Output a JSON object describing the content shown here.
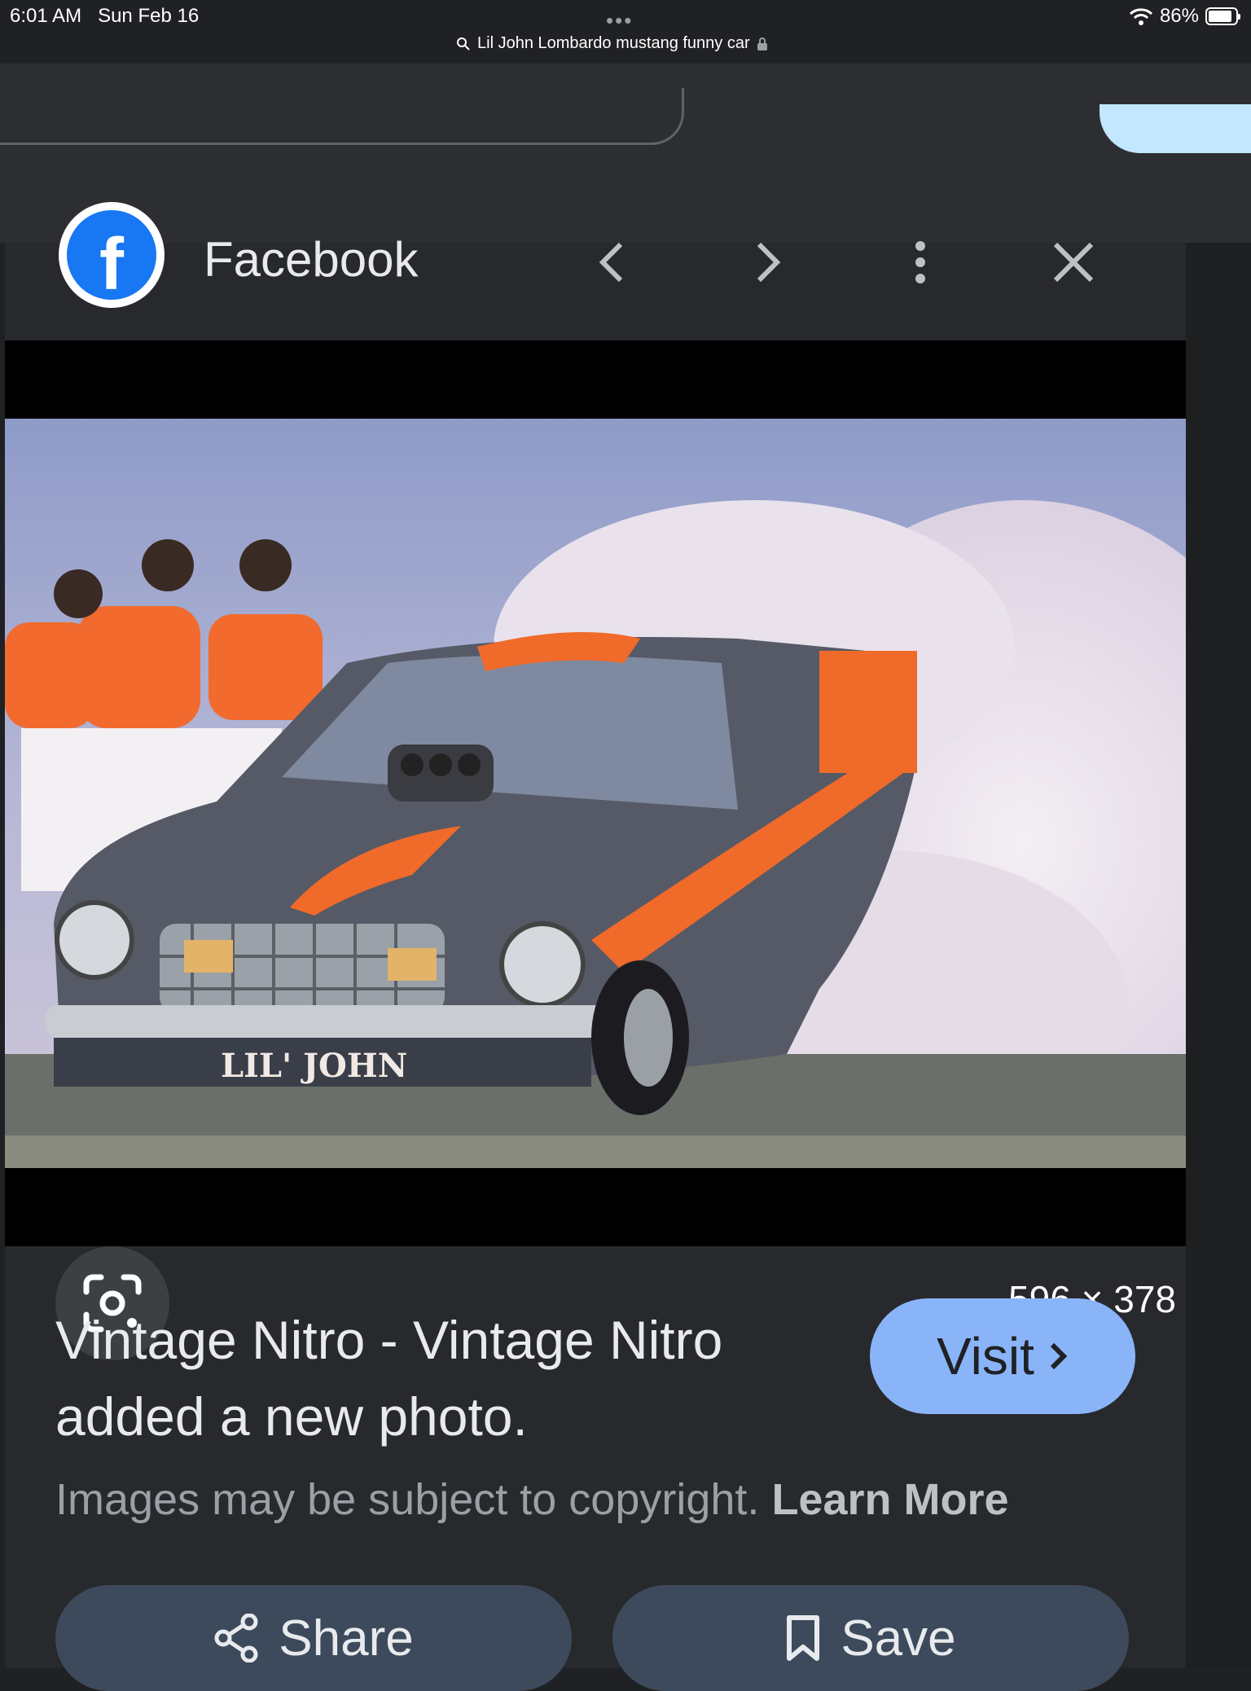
{
  "status_bar": {
    "time": "6:01 AM",
    "date": "Sun Feb 16",
    "url": "Lil John Lombardo mustang funny car",
    "battery": "86%",
    "battery_level": 0.86
  },
  "panel": {
    "source_name": "Facebook",
    "source_icon": "facebook-logo-icon",
    "image_dimensions": "596 × 378",
    "image_text": "LIL' JOHN",
    "title": "Vintage Nitro - Vintage Nitro added a new photo.",
    "visit_label": "Visit",
    "copyright_text": "Images may be subject to copyright.",
    "learn_more_label": "Learn More",
    "share_label": "Share",
    "save_label": "Save"
  },
  "colors": {
    "background": "#202124",
    "panel": "#28292c",
    "accent": "#8ab4f8",
    "button": "#3c4a5c"
  }
}
